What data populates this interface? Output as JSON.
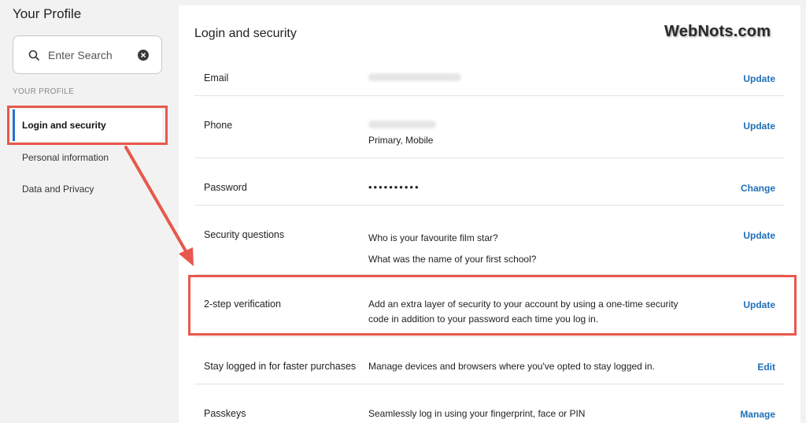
{
  "sidebar": {
    "title": "Your Profile",
    "search": {
      "placeholder": "Enter Search"
    },
    "section_label": "YOUR PROFILE",
    "items": [
      {
        "label": "Login and security",
        "active": true
      },
      {
        "label": "Personal information"
      },
      {
        "label": "Data and Privacy"
      }
    ]
  },
  "main": {
    "title": "Login and security",
    "brand": "WebNots.com",
    "rows": [
      {
        "label": "Email",
        "value": "",
        "action": "Update"
      },
      {
        "label": "Phone",
        "value": "Primary, Mobile",
        "action": "Update"
      },
      {
        "label": "Password",
        "value": "••••••••••",
        "action": "Change"
      },
      {
        "label": "Security questions",
        "value_lines": [
          "Who is your favourite film star?",
          "What was the name of your first school?"
        ],
        "action": "Update"
      },
      {
        "label": "2-step verification",
        "value_lines": [
          "Add an extra layer of security to your account by using a one-time security",
          "code in addition to your password each time you log in."
        ],
        "action": "Update"
      },
      {
        "label": "Stay logged in for faster purchases",
        "value": "Manage devices and browsers where you've opted to stay logged in.",
        "action": "Edit"
      },
      {
        "label": "Passkeys",
        "value": "Seamlessly log in using your fingerprint, face or PIN",
        "action": "Manage"
      }
    ]
  },
  "colors": {
    "accent": "#1f6fb8",
    "highlight": "#e8584c",
    "active_border": "#2b6ed2"
  }
}
